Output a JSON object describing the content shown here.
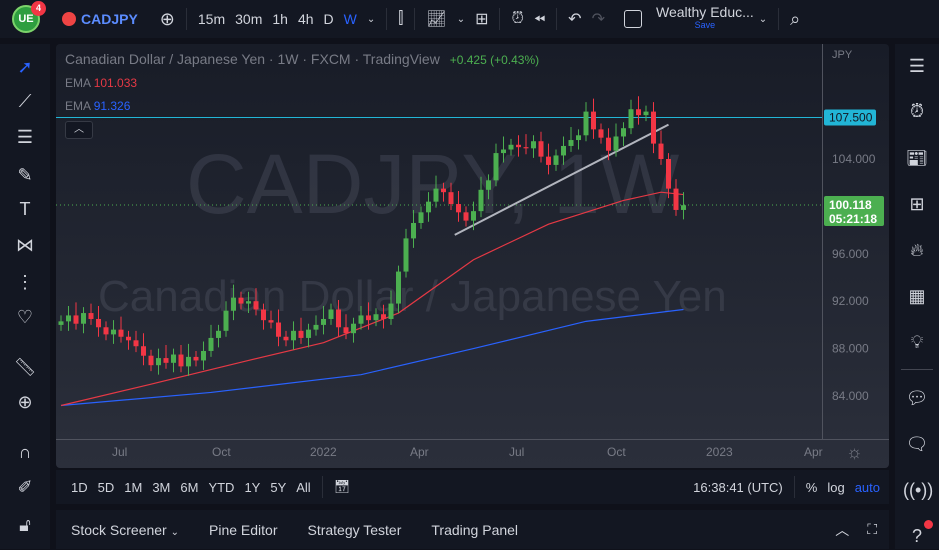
{
  "topbar": {
    "badge": "4",
    "symbol": "CADJPY",
    "intervals": [
      "15m",
      "30m",
      "1h",
      "4h",
      "D",
      "W"
    ],
    "active_interval": "W",
    "layout_name": "Wealthy Educ...",
    "save": "Save"
  },
  "legend": {
    "title": "Canadian Dollar / Japanese Yen · 1W · FXCM · TradingView",
    "change": "+0.425 (+0.43%)",
    "ema1_label": "EMA",
    "ema1_value": "101.033",
    "ema2_label": "EMA",
    "ema2_value": "91.326"
  },
  "watermark": {
    "symbol": "CADJPY, 1W",
    "name": "Canadian Dollar / Japanese Yen"
  },
  "price_axis": {
    "currency": "JPY",
    "ticks": [
      "104.000",
      "96.000",
      "92.000",
      "88.000",
      "84.000"
    ],
    "tick_values": [
      104,
      96,
      92,
      88,
      84
    ],
    "hline_label": "107.500",
    "hline_value": 107.5,
    "last_price": "100.118",
    "last_value": 100.118,
    "countdown": "05:21:18"
  },
  "time_axis": {
    "labels": [
      "Jul",
      "Oct",
      "2022",
      "Apr",
      "Jul",
      "Oct",
      "2023",
      "Apr"
    ]
  },
  "colors": {
    "up": "#4caf50",
    "down": "#f23645",
    "ema_fast": "#e53945",
    "ema_slow": "#2962ff",
    "hline": "#22b5d6",
    "accent": "#2962ff"
  },
  "chart_data": {
    "type": "candlestick",
    "closes": [
      90.3,
      90.8,
      90.1,
      91.0,
      90.5,
      89.8,
      89.2,
      89.6,
      89.0,
      88.7,
      88.2,
      87.4,
      86.6,
      87.2,
      86.8,
      87.5,
      86.5,
      87.3,
      87.0,
      87.8,
      88.9,
      89.5,
      91.2,
      92.3,
      91.8,
      92.0,
      91.3,
      90.4,
      90.2,
      89.0,
      88.7,
      89.5,
      88.9,
      89.6,
      90.0,
      90.5,
      91.3,
      89.8,
      89.3,
      90.1,
      90.8,
      90.4,
      90.9,
      90.5,
      91.8,
      94.5,
      97.3,
      98.6,
      99.5,
      100.4,
      101.5,
      101.2,
      100.2,
      99.5,
      98.8,
      99.6,
      101.4,
      102.2,
      104.5,
      104.8,
      105.2,
      105.0,
      104.9,
      105.5,
      104.2,
      103.5,
      104.3,
      105.1,
      105.6,
      106.0,
      108.0,
      106.5,
      105.8,
      104.7,
      105.9,
      106.6,
      108.2,
      107.7,
      108.0,
      105.3,
      104.0,
      101.5,
      99.7,
      100.1
    ],
    "ema_fast": [
      [
        0,
        83.2
      ],
      [
        12,
        85
      ],
      [
        25,
        87
      ],
      [
        35,
        88.5
      ],
      [
        45,
        91
      ],
      [
        55,
        95.5
      ],
      [
        65,
        98.5
      ],
      [
        75,
        100.5
      ],
      [
        80,
        101.2
      ],
      [
        83,
        101.0
      ]
    ],
    "ema_slow": [
      [
        0,
        83.2
      ],
      [
        20,
        84.3
      ],
      [
        40,
        85.8
      ],
      [
        55,
        88
      ],
      [
        70,
        90.3
      ],
      [
        83,
        91.3
      ]
    ],
    "trendline": [
      [
        52.5,
        97.6
      ],
      [
        81,
        106.9
      ]
    ]
  },
  "rangebar": {
    "ranges": [
      "1D",
      "5D",
      "1M",
      "3M",
      "6M",
      "YTD",
      "1Y",
      "5Y",
      "All"
    ],
    "clock": "16:38:41 (UTC)",
    "pct": "%",
    "log": "log",
    "auto": "auto"
  },
  "bottom": {
    "tabs": [
      "Stock Screener",
      "Pine Editor",
      "Strategy Tester",
      "Trading Panel"
    ]
  }
}
